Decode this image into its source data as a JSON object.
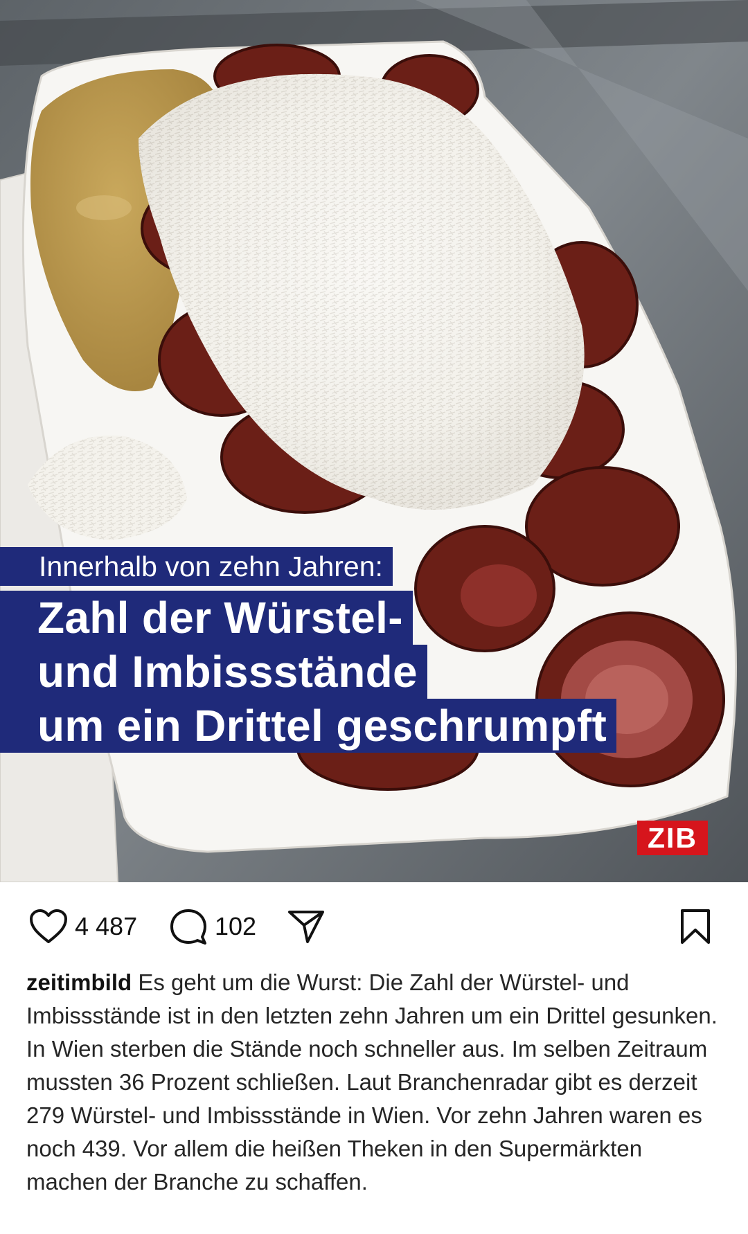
{
  "post": {
    "image": {
      "overlay_kicker": "Innerhalb von zehn Jahren:",
      "overlay_headline_lines": [
        "Zahl der Würstel-",
        "und Imbissstände",
        "um ein Drittel geschrumpft"
      ],
      "brand_logo_text": "ZIB",
      "colors": {
        "overlay_bg": "#1f2a7a",
        "logo_bg": "#d6151c"
      }
    },
    "actions": {
      "like_icon": "heart-icon",
      "like_count": "4 487",
      "comment_icon": "comment-bubble-icon",
      "comment_count": "102",
      "share_icon": "send-icon",
      "save_icon": "bookmark-icon"
    },
    "caption": {
      "username": "zeitimbild",
      "text": "Es geht um die Wurst: Die Zahl der Würstel- und Imbissstände ist in den letzten zehn Jahren um ein Drittel gesunken. In Wien sterben die Stände noch schneller aus. Im selben Zeitraum mussten 36 Prozent schließen. Laut Branchenradar gibt es derzeit 279 Würstel- und Imbissstände in Wien. Vor zehn Jahren waren es noch 439. Vor allem die heißen Theken in den Supermärkten machen der Branche zu schaffen."
    }
  }
}
